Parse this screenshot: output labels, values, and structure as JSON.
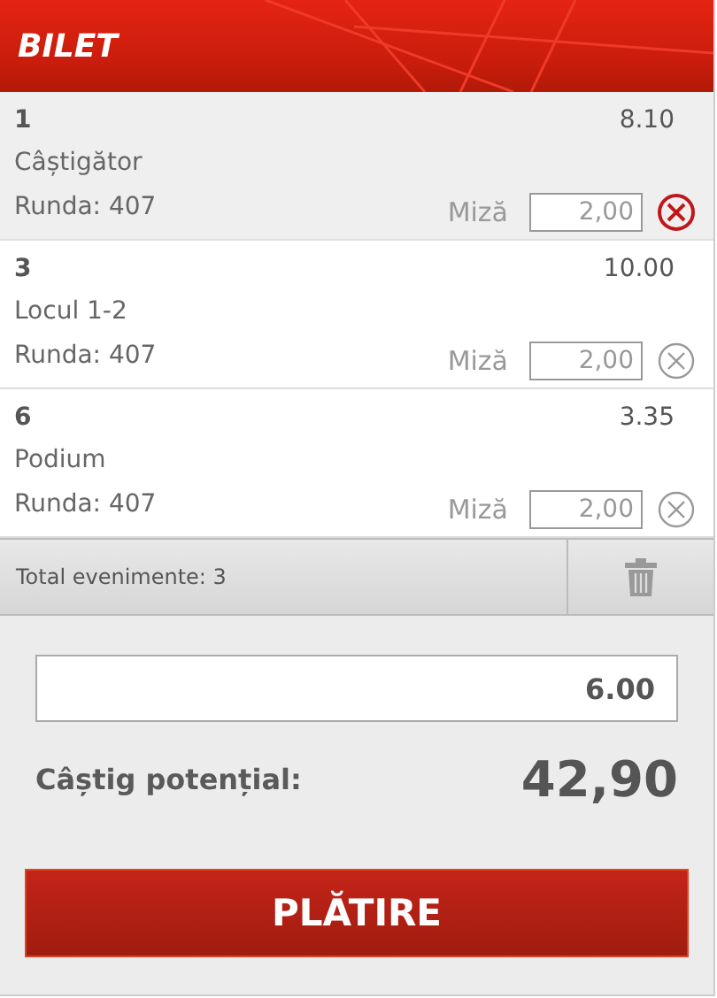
{
  "header": {
    "title": "BILET"
  },
  "bets": [
    {
      "number": "1",
      "odds": "8.10",
      "selection": "Câștigător",
      "round": "Runda: 407",
      "stake_label": "Miză",
      "stake": "2,00",
      "selected": true
    },
    {
      "number": "3",
      "odds": "10.00",
      "selection": "Locul 1-2",
      "round": "Runda: 407",
      "stake_label": "Miză",
      "stake": "2,00",
      "selected": false
    },
    {
      "number": "6",
      "odds": "3.35",
      "selection": "Podium",
      "round": "Runda: 407",
      "stake_label": "Miză",
      "stake": "2,00",
      "selected": false
    }
  ],
  "summary": {
    "total_events": "Total evenimente: 3"
  },
  "total_stake": {
    "value": "6.00"
  },
  "potential_win": {
    "label": "Câștig potențial:",
    "value": "42,90"
  },
  "pay_button": {
    "label": "PLĂTIRE"
  }
}
